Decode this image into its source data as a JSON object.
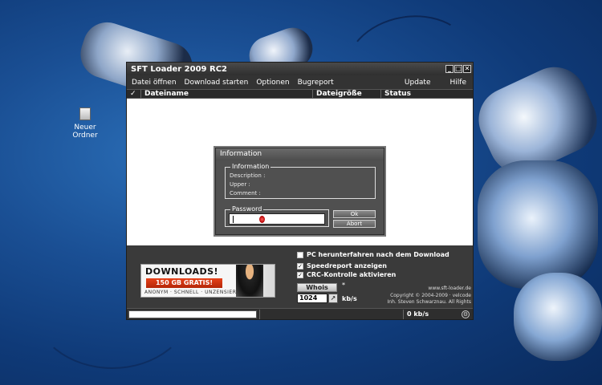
{
  "desktop": {
    "icon_label": "Neuer Ordner"
  },
  "window": {
    "title": "SFT Loader 2009 RC2",
    "buttons": {
      "minimize": "_",
      "maximize": "□",
      "close": "✕"
    }
  },
  "menu": {
    "left": [
      "Datei öffnen",
      "Download starten",
      "Optionen",
      "Bugreport"
    ],
    "right": [
      "Update",
      "Hilfe"
    ]
  },
  "table": {
    "check_header": "✓",
    "columns": [
      "Dateiname",
      "Dateigröße",
      "Status"
    ]
  },
  "dialog": {
    "title": "Information",
    "info_group": "Information",
    "info_lines": [
      "Description :",
      "Upper :",
      "Comment :"
    ],
    "password_group": "Password",
    "password_value": "",
    "ok_label": "Ok",
    "abort_label": "Abort"
  },
  "ad": {
    "title": "DOWNLOADS!",
    "badge": "150 GB GRATIS!",
    "sub": "ANONYM · SCHNELL · UNZENSIERT"
  },
  "options": {
    "shutdown": {
      "label": "PC herunterfahren nach dem Download",
      "checked": false
    },
    "speedreport": {
      "label": "Speedreport anzeigen",
      "checked": true
    },
    "crc": {
      "label": "CRC-Kontrolle aktivieren",
      "checked": true
    }
  },
  "whois_label": "Whois",
  "whois_star": "*",
  "speed": {
    "value": "1024",
    "unit": "kb/s"
  },
  "credits": {
    "url": "www.sft-loader.de",
    "copyright": "Copyright © 2004-2009 · velcode",
    "author": "Inh. Steven Schwarznau. All Rights"
  },
  "status": {
    "rate": "0 kb/s"
  }
}
